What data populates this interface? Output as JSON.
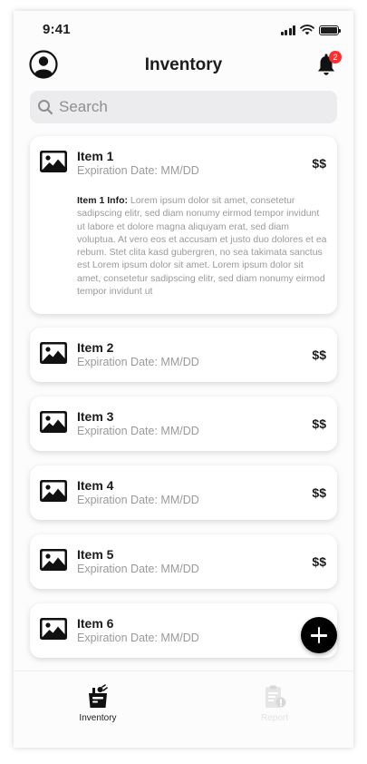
{
  "status_bar": {
    "time": "9:41"
  },
  "header": {
    "title": "Inventory",
    "notification_count": "2"
  },
  "search": {
    "placeholder": "Search"
  },
  "items": [
    {
      "name": "Item 1",
      "expiration": "Expiration Date: MM/DD",
      "price": "$$",
      "info_label": "Item 1 Info:",
      "info_text": " Lorem ipsum dolor sit amet, consetetur sadipscing elitr, sed diam nonumy eirmod tempor invidunt ut labore et dolore magna aliquyam erat, sed diam voluptua. At vero eos et accusam et justo duo dolores et ea rebum. Stet clita kasd gubergren, no sea takimata sanctus est Lorem ipsum dolor sit amet. Lorem ipsum dolor sit amet, consetetur sadipscing elitr, sed diam nonumy eirmod tempor invidunt ut"
    },
    {
      "name": "Item 2",
      "expiration": "Expiration Date: MM/DD",
      "price": "$$"
    },
    {
      "name": "Item 3",
      "expiration": "Expiration Date: MM/DD",
      "price": "$$"
    },
    {
      "name": "Item 4",
      "expiration": "Expiration Date: MM/DD",
      "price": "$$"
    },
    {
      "name": "Item 5",
      "expiration": "Expiration Date: MM/DD",
      "price": "$$"
    },
    {
      "name": "Item 6",
      "expiration": "Expiration Date: MM/DD",
      "price": "$$"
    }
  ],
  "tabs": [
    {
      "label": "Inventory",
      "active": true
    },
    {
      "label": "Report",
      "active": false
    }
  ],
  "colors": {
    "badge": "#ff2d2d",
    "fab": "#000000",
    "inactive_tab": "#e2e2e4"
  }
}
